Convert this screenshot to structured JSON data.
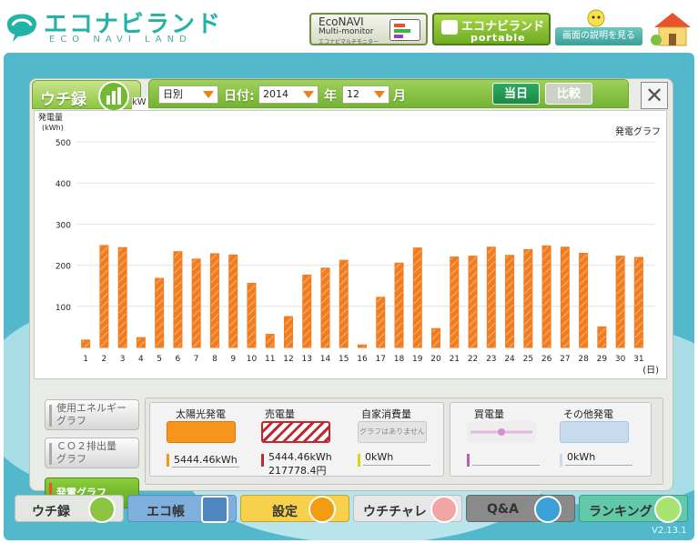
{
  "header": {
    "logo_text": "エコナビランド",
    "logo_sub": "ECO NAVI LAND",
    "econavi": {
      "line1": "EcoNAVI",
      "line2": "Multi-monitor",
      "line3": "エコナビマルチモニター"
    },
    "portable": {
      "line1": "エコナビランド",
      "line2": "portable"
    },
    "help_label": "画面の説明を見る"
  },
  "window": {
    "tab_label": "ウチ録",
    "kw_tab": "kW",
    "toolbar": {
      "mode_value": "日別",
      "date_label": "日付:",
      "year_value": "2014",
      "year_unit": "年",
      "month_value": "12",
      "month_unit": "月",
      "today_label": "当日",
      "compare_label": "比較"
    },
    "close_label": "✕"
  },
  "chart_data": {
    "type": "bar",
    "title": "発電グラフ",
    "ylabel": "発電量\n(kWh)",
    "xlabel": "(日)",
    "ylim": [
      0,
      500
    ],
    "yticks": [
      100,
      200,
      300,
      400,
      500
    ],
    "categories": [
      "1",
      "2",
      "3",
      "4",
      "5",
      "6",
      "7",
      "8",
      "9",
      "10",
      "11",
      "12",
      "13",
      "14",
      "15",
      "16",
      "17",
      "18",
      "19",
      "20",
      "21",
      "22",
      "23",
      "24",
      "25",
      "26",
      "27",
      "28",
      "29",
      "30",
      "31"
    ],
    "values": [
      18,
      248,
      243,
      24,
      168,
      233,
      215,
      228,
      225,
      156,
      32,
      75,
      176,
      193,
      212,
      6,
      122,
      205,
      242,
      46,
      220,
      222,
      244,
      224,
      238,
      247,
      244,
      229,
      50,
      222,
      219
    ],
    "bar_color": "#f47a1f",
    "hatch_color": "#e9b36a"
  },
  "side": {
    "usage_graph": "使用エネルギー\nグラフ",
    "co2_graph": "ＣＯ２排出量\nグラフ",
    "power_graph": "発電グラフ"
  },
  "summary": {
    "solar": {
      "title": "太陽光発電",
      "value": "5444.46kWh",
      "color": "#f7941d"
    },
    "sell": {
      "title": "売電量",
      "value": "5444.46kWh",
      "yen": "217778.4円",
      "color": "#c1272d"
    },
    "self": {
      "title": "自家消費量",
      "no_graph": "グラフはありません",
      "value": "0kWh",
      "color": "#d6d90f"
    },
    "buy": {
      "title": "買電量",
      "value": "",
      "color": "#b560b8"
    },
    "other": {
      "title": "その他発電",
      "value": "0kWh",
      "color": "#c8daf0"
    }
  },
  "nav": {
    "items": [
      {
        "label": "ウチ録"
      },
      {
        "label": "エコ帳"
      },
      {
        "label": "設定"
      },
      {
        "label": "ウチチャレ"
      },
      {
        "label": "Q&A"
      },
      {
        "label": "ランキング"
      }
    ]
  },
  "version": "V2.13.1"
}
